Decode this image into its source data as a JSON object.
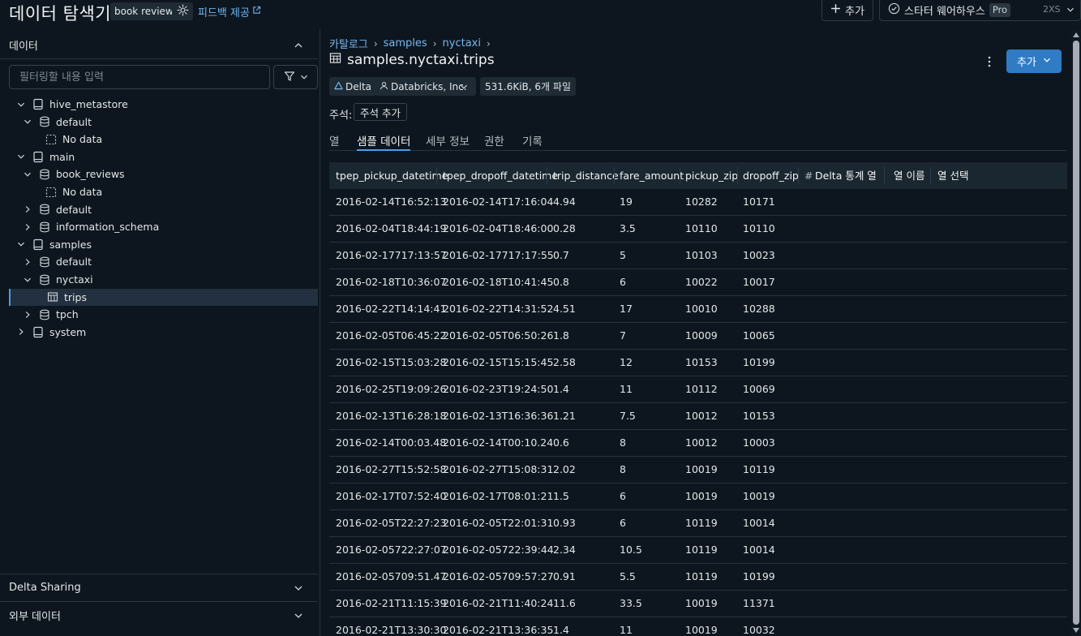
{
  "app": {
    "title": "데이터 탐색기",
    "context_badge": "book reviews",
    "feedback_label": "피드백 제공"
  },
  "topbar": {
    "add_label": "추가",
    "warehouse_name": "스타터 웨어하우스",
    "warehouse_tier": "Pro",
    "warehouse_size": "2XS",
    "warehouse_status": "running"
  },
  "sidebar": {
    "data_section_title": "데이터",
    "filter_placeholder": "필터링할 내용 입력",
    "tree": [
      {
        "label": "hive_metastore",
        "level": 0,
        "type": "catalog",
        "expanded": true
      },
      {
        "label": "default",
        "level": 1,
        "type": "schema",
        "expanded": true
      },
      {
        "label": "No data",
        "level": 2,
        "type": "empty"
      },
      {
        "label": "main",
        "level": 0,
        "type": "catalog",
        "expanded": true
      },
      {
        "label": "book_reviews",
        "level": 1,
        "type": "schema",
        "expanded": true
      },
      {
        "label": "No data",
        "level": 2,
        "type": "empty"
      },
      {
        "label": "default",
        "level": 1,
        "type": "schema",
        "expanded": false
      },
      {
        "label": "information_schema",
        "level": 1,
        "type": "schema",
        "expanded": false
      },
      {
        "label": "samples",
        "level": 0,
        "type": "catalog",
        "expanded": true
      },
      {
        "label": "default",
        "level": 1,
        "type": "schema",
        "expanded": false
      },
      {
        "label": "nyctaxi",
        "level": 1,
        "type": "schema",
        "expanded": true
      },
      {
        "label": "trips",
        "level": 2,
        "type": "table",
        "selected": true
      },
      {
        "label": "tpch",
        "level": 1,
        "type": "schema",
        "expanded": false
      },
      {
        "label": "system",
        "level": 0,
        "type": "catalog",
        "expanded": false
      }
    ],
    "delta_sharing_title": "Delta Sharing",
    "external_data_title": "외부 데이터"
  },
  "main": {
    "breadcrumb": [
      "카탈로그",
      "samples",
      "nyctaxi"
    ],
    "table_name": "samples.nyctaxi.trips",
    "add_button_label": "추가",
    "chips": {
      "format": "Delta",
      "owner": "Databricks, Inc.",
      "size": "531.6KiB, 6개 파일"
    },
    "comment_label": "주석:",
    "add_comment_label": "주석 추가",
    "tabs": [
      "열",
      "샘플 데이터",
      "세부 정보",
      "권한",
      "기록"
    ],
    "active_tab": 1,
    "columns": [
      "tpep_pickup_datetime",
      "tpep_dropoff_datetime",
      "trip_distance",
      "fare_amount",
      "pickup_zip",
      "dropoff_zip"
    ],
    "extra_columns": {
      "delta_stats_prefix": "#",
      "delta_stats_label": "Delta 통계 열",
      "column_name_label": "열 이름",
      "column_select_label": "열 선택"
    },
    "rows": [
      [
        "2016-02-14T16:52:13",
        "2016-02-14T17:16:04",
        "4.94",
        "19",
        "10282",
        "10171"
      ],
      [
        "2016-02-04T18:44:19",
        "2016-02-04T18:46:00",
        "0.28",
        "3.5",
        "10110",
        "10110"
      ],
      [
        "2016-02-17717:13:57",
        "2016-02-17717:17:55",
        "0.7",
        "5",
        "10103",
        "10023"
      ],
      [
        "2016-02-18T10:36:07",
        "2016-02-18T10:41:45",
        "0.8",
        "6",
        "10022",
        "10017"
      ],
      [
        "2016-02-22T14:14:41",
        "2016-02-22T14:31:52",
        "4.51",
        "17",
        "10010",
        "10288"
      ],
      [
        "2016-02-05T06:45:22",
        "2016-02-05T06:50:26",
        "1.8",
        "7",
        "10009",
        "10065"
      ],
      [
        "2016-02-15T15:03:28",
        "2016-02-15T15:15:45",
        "2.58",
        "12",
        "10153",
        "10199"
      ],
      [
        "2016-02-25T19:09:26",
        "2016-02-23T19:24:50",
        "1.4",
        "11",
        "10112",
        "10069"
      ],
      [
        "2016-02-13T16:28:18",
        "2016-02-13T16:36:36",
        "1.21",
        "7.5",
        "10012",
        "10153"
      ],
      [
        "2016-02-14T00:03.48",
        "2016-02-14T00:10.24",
        "0.6",
        "8",
        "10012",
        "10003"
      ],
      [
        "2016-02-27T15:52:58",
        "2016-02-27T15:08:31",
        "2.02",
        "8",
        "10019",
        "10119"
      ],
      [
        "2016-02-17T07:52:40",
        "2016-02-17T08:01:21",
        "1.5",
        "6",
        "10019",
        "10019"
      ],
      [
        "2016-02-05T22:27:23",
        "2016-02-05T22:01:31",
        "0.93",
        "6",
        "10119",
        "10014"
      ],
      [
        "2016-02-05722:27:07",
        "2016-02-05722:39:44",
        "2.34",
        "10.5",
        "10119",
        "10014"
      ],
      [
        "2016-02-05709:51.47",
        "2016-02-05709:57:27",
        "0.91",
        "5.5",
        "10119",
        "10199"
      ],
      [
        "2016-02-21T11:15:39",
        "2016-02-21T11:40:24",
        "11.6",
        "33.5",
        "10019",
        "11371"
      ],
      [
        "2016-02-21T13:30:30",
        "2016-02-21T13:36:35",
        "1.4",
        "11",
        "10019",
        "10032"
      ]
    ]
  }
}
